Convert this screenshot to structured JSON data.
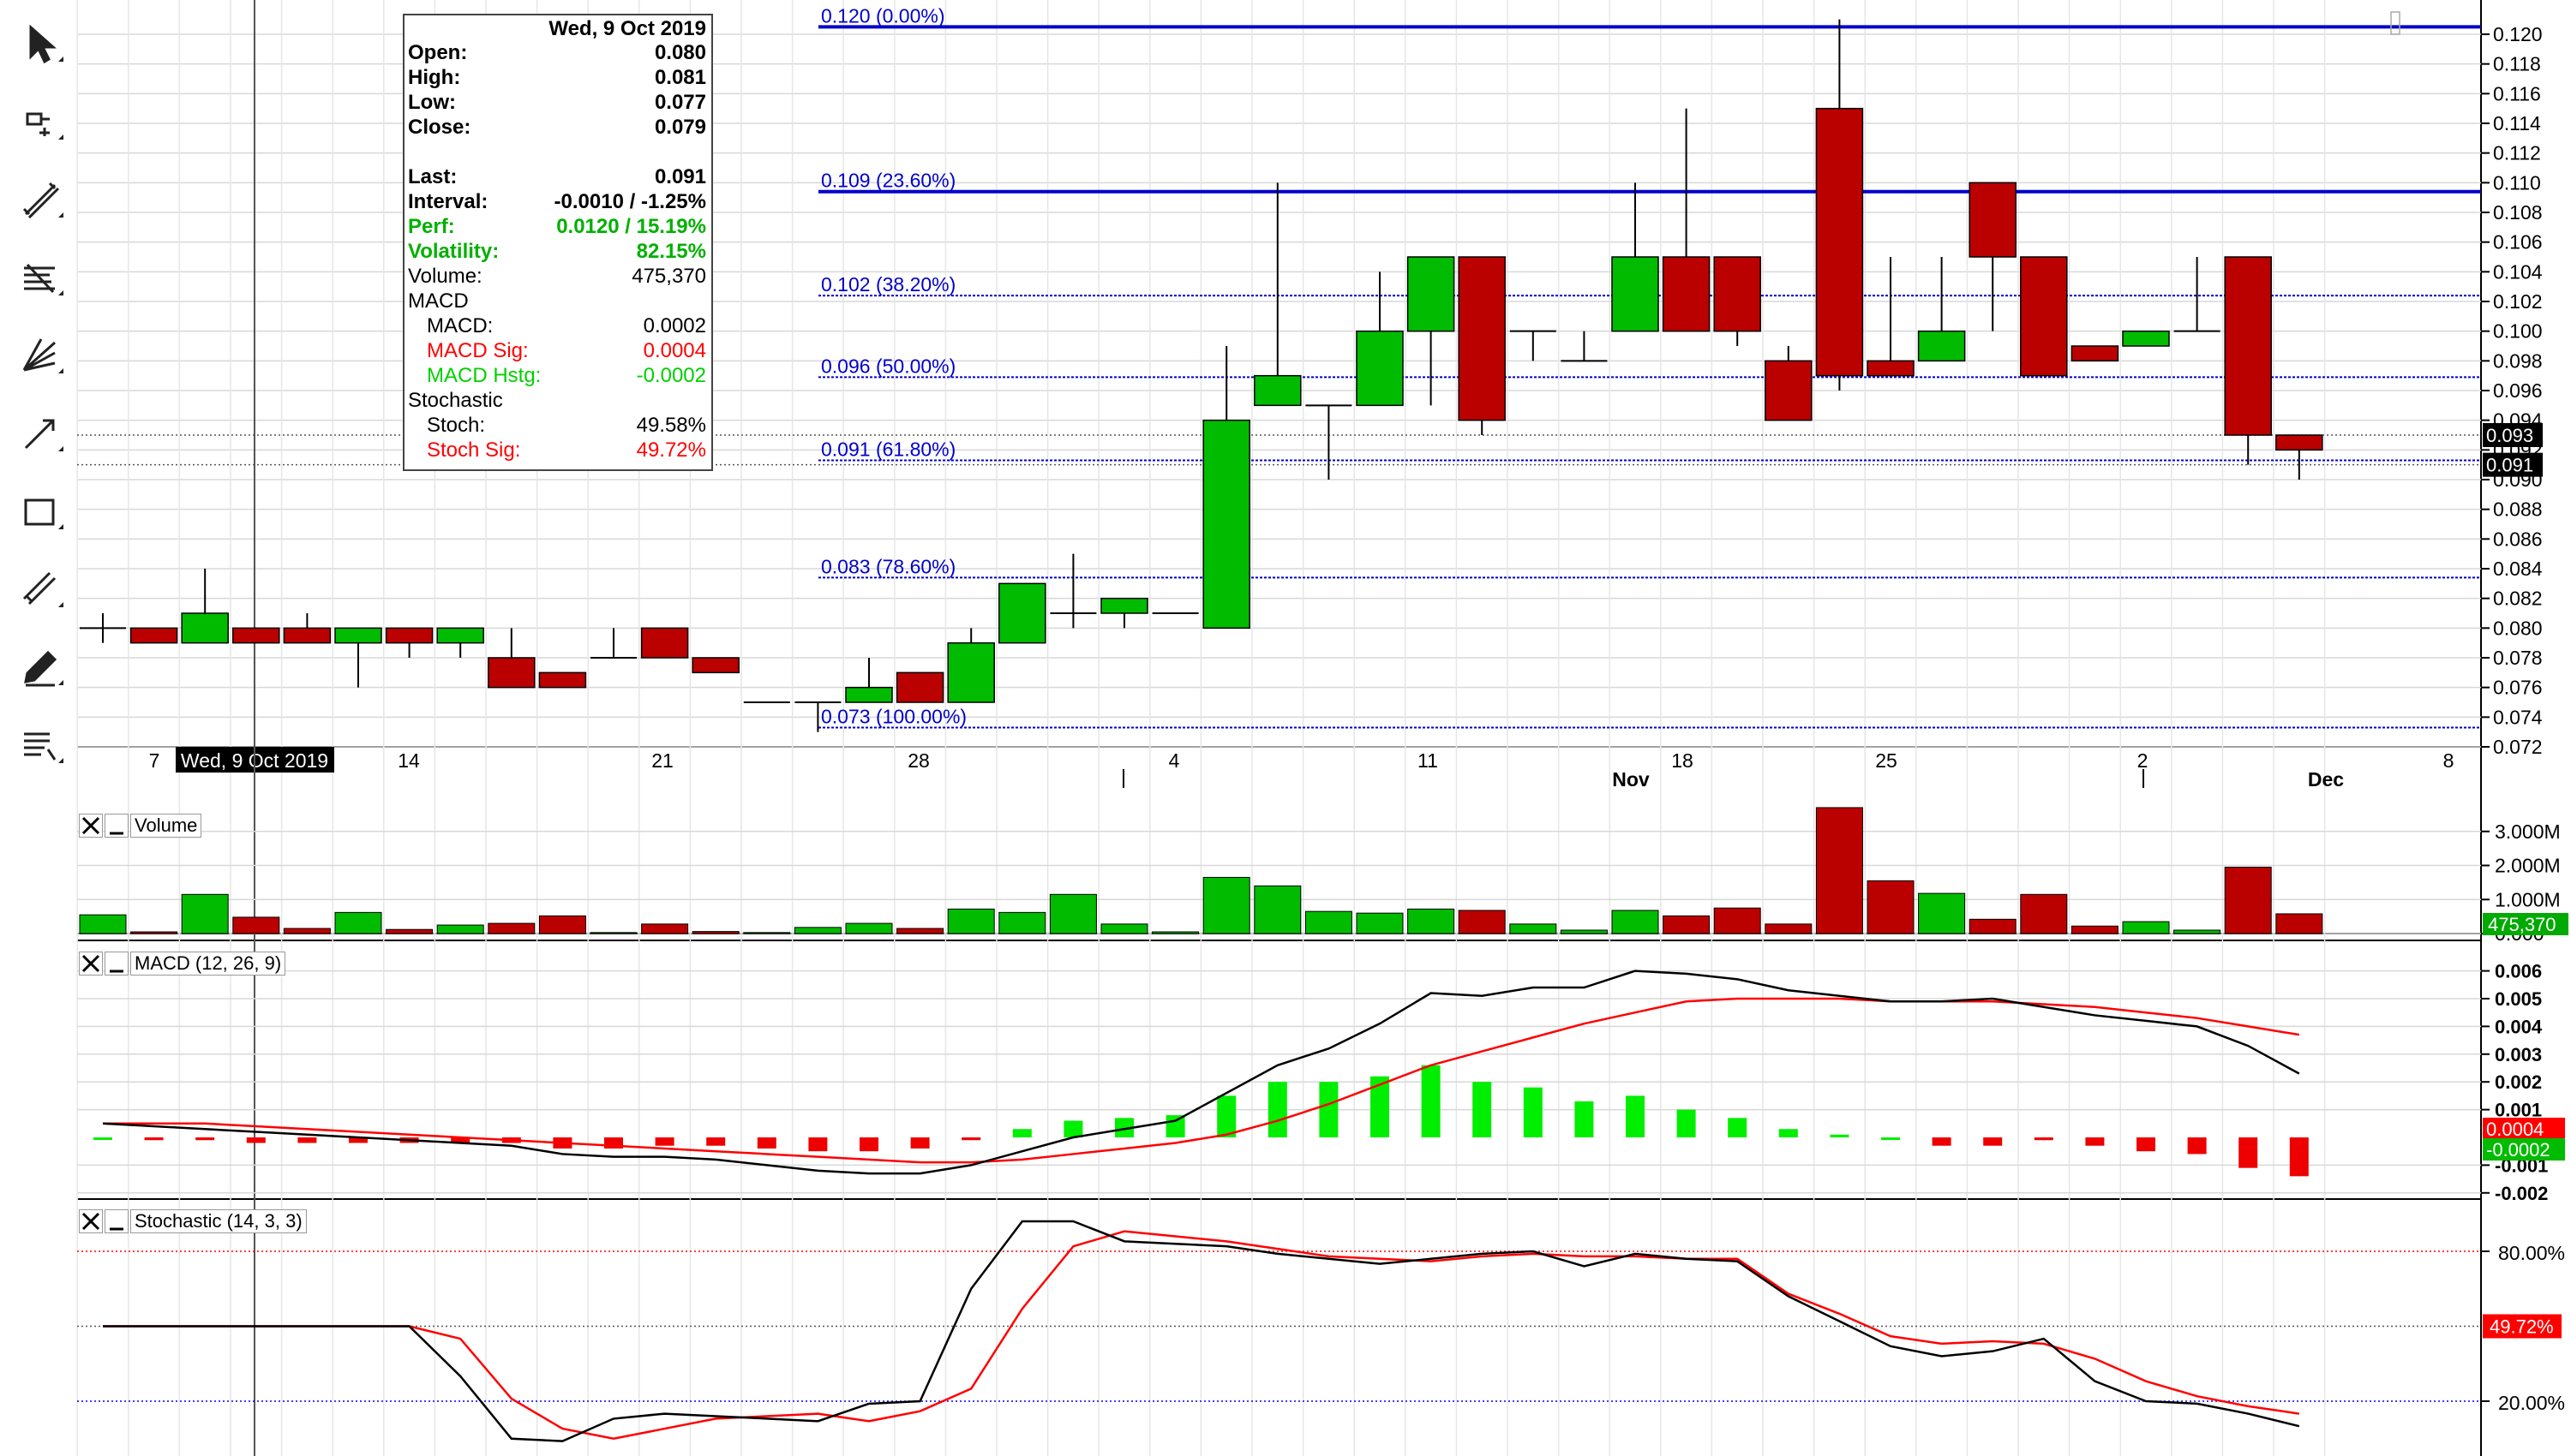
{
  "toolbar": {
    "icons": [
      "pointer-icon",
      "crosshair-icon",
      "trendline-icon",
      "fibonacci-icon",
      "gann-fan-icon",
      "arrow-icon",
      "rectangle-icon",
      "channel-icon",
      "pencil-icon",
      "list-icon"
    ]
  },
  "info_box": {
    "date": "Wed, 9 Oct 2019",
    "rows": [
      {
        "label": "Open:",
        "value": "0.080",
        "style": "b"
      },
      {
        "label": "High:",
        "value": "0.081",
        "style": "b"
      },
      {
        "label": "Low:",
        "value": "0.077",
        "style": "b"
      },
      {
        "label": "Close:",
        "value": "0.079",
        "style": "b"
      },
      {
        "label": "",
        "value": "",
        "style": ""
      },
      {
        "label": "Last:",
        "value": "0.091",
        "style": "b"
      },
      {
        "label": "Interval:",
        "value": "-0.0010 / -1.25%",
        "style": "b"
      },
      {
        "label": "Perf:",
        "value": "0.0120 / 15.19%",
        "style": "b g"
      },
      {
        "label": "Volatility:",
        "value": "82.15%",
        "style": "b g"
      },
      {
        "label": "Volume:",
        "value": "475,370",
        "style": ""
      },
      {
        "label": "MACD",
        "value": "",
        "style": ""
      },
      {
        "label": "  MACD:",
        "value": "0.0002",
        "style": "ind"
      },
      {
        "label": "  MACD Sig:",
        "value": "0.0004",
        "style": "ind r"
      },
      {
        "label": "  MACD Hstg:",
        "value": "-0.0002",
        "style": "ind lg"
      },
      {
        "label": "Stochastic",
        "value": "",
        "style": ""
      },
      {
        "label": "  Stoch:",
        "value": "49.58%",
        "style": "ind"
      },
      {
        "label": "  Stoch Sig:",
        "value": "49.72%",
        "style": "ind r"
      }
    ]
  },
  "panels": {
    "volume_title": "Volume",
    "macd_title": "MACD (12, 26, 9)",
    "stoch_title": "Stochastic (14, 3, 3)"
  },
  "colors": {
    "up": "#00bb00",
    "down": "#bb0000",
    "fib": "#0000cc",
    "grid": "#d8d8d8",
    "crosshair": "#555555"
  },
  "chart_data": {
    "type": "candlestick",
    "x_labels": [
      "7",
      "Wed, 9 Oct 2019",
      "14",
      "21",
      "28",
      "4",
      "11",
      "18",
      "25",
      "2",
      "8"
    ],
    "month_labels": [
      "Nov",
      "Dec"
    ],
    "y_ticks": [
      "0.120",
      "0.118",
      "0.116",
      "0.114",
      "0.112",
      "0.110",
      "0.108",
      "0.106",
      "0.104",
      "0.102",
      "0.100",
      "0.098",
      "0.096",
      "0.094",
      "0.092",
      "0.090",
      "0.088",
      "0.086",
      "0.084",
      "0.082",
      "0.080",
      "0.078",
      "0.076",
      "0.074",
      "0.072"
    ],
    "price_labels": {
      "last": "0.091",
      "prev": "0.093",
      "hidden": "0.092"
    },
    "fib_levels": [
      {
        "price": 0.1205,
        "label": "0.120  (0.00%)"
      },
      {
        "price": 0.1094,
        "label": "0.109  (23.60%)"
      },
      {
        "price": 0.1024,
        "label": "0.102  (38.20%)"
      },
      {
        "price": 0.0969,
        "label": "0.096  (50.00%)"
      },
      {
        "price": 0.0913,
        "label": "0.091  (61.80%)"
      },
      {
        "price": 0.0834,
        "label": "0.083  (78.60%)"
      },
      {
        "price": 0.0733,
        "label": "0.073  (100.00%)"
      }
    ],
    "candles": [
      {
        "o": 0.08,
        "h": 0.081,
        "l": 0.079,
        "c": 0.08,
        "v": 0.55
      },
      {
        "o": 0.08,
        "h": 0.08,
        "l": 0.079,
        "c": 0.079,
        "v": 0.05
      },
      {
        "o": 0.079,
        "h": 0.084,
        "l": 0.079,
        "c": 0.081,
        "v": 1.15
      },
      {
        "o": 0.08,
        "h": 0.08,
        "l": 0.079,
        "c": 0.079,
        "v": 0.48
      },
      {
        "o": 0.08,
        "h": 0.081,
        "l": 0.079,
        "c": 0.079,
        "v": 0.15
      },
      {
        "o": 0.079,
        "h": 0.08,
        "l": 0.076,
        "c": 0.08,
        "v": 0.62
      },
      {
        "o": 0.08,
        "h": 0.08,
        "l": 0.078,
        "c": 0.079,
        "v": 0.12
      },
      {
        "o": 0.079,
        "h": 0.08,
        "l": 0.078,
        "c": 0.08,
        "v": 0.25
      },
      {
        "o": 0.078,
        "h": 0.08,
        "l": 0.076,
        "c": 0.076,
        "v": 0.3
      },
      {
        "o": 0.077,
        "h": 0.077,
        "l": 0.076,
        "c": 0.076,
        "v": 0.52
      },
      {
        "o": 0.078,
        "h": 0.08,
        "l": 0.078,
        "c": 0.078,
        "v": 0.03
      },
      {
        "o": 0.08,
        "h": 0.08,
        "l": 0.078,
        "c": 0.078,
        "v": 0.28
      },
      {
        "o": 0.078,
        "h": 0.078,
        "l": 0.077,
        "c": 0.077,
        "v": 0.06
      },
      {
        "o": 0.075,
        "h": 0.075,
        "l": 0.075,
        "c": 0.075,
        "v": 0.03
      },
      {
        "o": 0.075,
        "h": 0.075,
        "l": 0.073,
        "c": 0.075,
        "v": 0.18
      },
      {
        "o": 0.075,
        "h": 0.078,
        "l": 0.075,
        "c": 0.076,
        "v": 0.3
      },
      {
        "o": 0.077,
        "h": 0.077,
        "l": 0.075,
        "c": 0.075,
        "v": 0.15
      },
      {
        "o": 0.075,
        "h": 0.08,
        "l": 0.075,
        "c": 0.079,
        "v": 0.72
      },
      {
        "o": 0.079,
        "h": 0.083,
        "l": 0.079,
        "c": 0.083,
        "v": 0.62
      },
      {
        "o": 0.081,
        "h": 0.085,
        "l": 0.08,
        "c": 0.081,
        "v": 1.15
      },
      {
        "o": 0.081,
        "h": 0.082,
        "l": 0.08,
        "c": 0.082,
        "v": 0.28
      },
      {
        "o": 0.081,
        "h": 0.081,
        "l": 0.081,
        "c": 0.081,
        "v": 0.05
      },
      {
        "o": 0.08,
        "h": 0.099,
        "l": 0.08,
        "c": 0.094,
        "v": 1.65
      },
      {
        "o": 0.095,
        "h": 0.11,
        "l": 0.095,
        "c": 0.097,
        "v": 1.4
      },
      {
        "o": 0.095,
        "h": 0.095,
        "l": 0.09,
        "c": 0.095,
        "v": 0.65
      },
      {
        "o": 0.095,
        "h": 0.104,
        "l": 0.095,
        "c": 0.1,
        "v": 0.6
      },
      {
        "o": 0.1,
        "h": 0.105,
        "l": 0.095,
        "c": 0.105,
        "v": 0.72
      },
      {
        "o": 0.105,
        "h": 0.105,
        "l": 0.093,
        "c": 0.094,
        "v": 0.68
      },
      {
        "o": 0.1,
        "h": 0.1,
        "l": 0.098,
        "c": 0.1,
        "v": 0.28
      },
      {
        "o": 0.098,
        "h": 0.1,
        "l": 0.098,
        "c": 0.098,
        "v": 0.1
      },
      {
        "o": 0.1,
        "h": 0.11,
        "l": 0.1,
        "c": 0.105,
        "v": 0.68
      },
      {
        "o": 0.105,
        "h": 0.115,
        "l": 0.1,
        "c": 0.1,
        "v": 0.52
      },
      {
        "o": 0.105,
        "h": 0.105,
        "l": 0.099,
        "c": 0.1,
        "v": 0.75
      },
      {
        "o": 0.098,
        "h": 0.099,
        "l": 0.094,
        "c": 0.094,
        "v": 0.28
      },
      {
        "o": 0.115,
        "h": 0.121,
        "l": 0.096,
        "c": 0.097,
        "v": 3.7
      },
      {
        "o": 0.098,
        "h": 0.105,
        "l": 0.097,
        "c": 0.097,
        "v": 1.55
      },
      {
        "o": 0.098,
        "h": 0.105,
        "l": 0.098,
        "c": 0.1,
        "v": 1.18
      },
      {
        "o": 0.11,
        "h": 0.11,
        "l": 0.1,
        "c": 0.105,
        "v": 0.42
      },
      {
        "o": 0.105,
        "h": 0.105,
        "l": 0.097,
        "c": 0.097,
        "v": 1.15
      },
      {
        "o": 0.099,
        "h": 0.099,
        "l": 0.098,
        "c": 0.098,
        "v": 0.22
      },
      {
        "o": 0.099,
        "h": 0.1,
        "l": 0.099,
        "c": 0.1,
        "v": 0.35
      },
      {
        "o": 0.1,
        "h": 0.105,
        "l": 0.1,
        "c": 0.1,
        "v": 0.1
      },
      {
        "o": 0.105,
        "h": 0.105,
        "l": 0.091,
        "c": 0.093,
        "v": 1.95
      },
      {
        "o": 0.093,
        "h": 0.093,
        "l": 0.09,
        "c": 0.092,
        "v": 0.58
      }
    ],
    "volume_ticks": [
      "3.000M",
      "2.000M",
      "1.000M",
      "0.000"
    ],
    "volume_last": "475,370",
    "macd": {
      "ticks": [
        "0.006",
        "0.005",
        "0.004",
        "0.003",
        "0.002",
        "0.001",
        "-0.001",
        "-0.002"
      ],
      "macd": [
        0.0005,
        0.0004,
        0.0003,
        0.0002,
        0.0001,
        0.0,
        -0.0001,
        -0.0002,
        -0.0003,
        -0.0006,
        -0.0007,
        -0.0007,
        -0.0008,
        -0.001,
        -0.0012,
        -0.0013,
        -0.0013,
        -0.001,
        -0.0005,
        0.0,
        0.0003,
        0.0006,
        0.0016,
        0.0026,
        0.0032,
        0.0041,
        0.0052,
        0.0051,
        0.0054,
        0.0054,
        0.006,
        0.0059,
        0.0057,
        0.0053,
        0.0051,
        0.0049,
        0.0049,
        0.005,
        0.0047,
        0.0044,
        0.0042,
        0.004,
        0.0033,
        0.0023
      ],
      "signal": [
        0.0005,
        0.0005,
        0.0005,
        0.0004,
        0.0003,
        0.0002,
        0.0001,
        0.0,
        -0.0001,
        -0.0002,
        -0.0003,
        -0.0004,
        -0.0005,
        -0.0006,
        -0.0007,
        -0.0008,
        -0.0009,
        -0.0009,
        -0.0008,
        -0.0006,
        -0.0004,
        -0.0002,
        0.0001,
        0.0006,
        0.0012,
        0.0019,
        0.0026,
        0.0031,
        0.0036,
        0.0041,
        0.0045,
        0.0049,
        0.005,
        0.005,
        0.005,
        0.0049,
        0.0049,
        0.0049,
        0.0048,
        0.0047,
        0.0045,
        0.0043,
        0.004,
        0.0037
      ],
      "hist": [
        0.0,
        -0.0001,
        -0.0001,
        -0.0002,
        -0.0002,
        -0.0002,
        -0.0002,
        -0.0002,
        -0.0002,
        -0.0004,
        -0.0004,
        -0.0003,
        -0.0003,
        -0.0004,
        -0.0005,
        -0.0005,
        -0.0004,
        -0.0001,
        0.0003,
        0.0006,
        0.0007,
        0.0008,
        0.0015,
        0.002,
        0.002,
        0.0022,
        0.0026,
        0.002,
        0.0018,
        0.0013,
        0.0015,
        0.001,
        0.0007,
        0.0003,
        0.0001,
        0.0,
        -0.0003,
        -0.0003,
        -0.0001,
        -0.0003,
        -0.0005,
        -0.0006,
        -0.0011,
        -0.0014
      ],
      "macd_label": "0.0004",
      "hist_label": "-0.0002"
    },
    "stochastic": {
      "ticks": [
        "80.00%",
        "20.00%"
      ],
      "stoch": [
        50,
        50,
        50,
        50,
        50,
        50,
        50,
        30,
        5,
        4,
        13,
        15,
        14,
        13,
        12,
        19,
        20,
        65,
        92,
        92,
        84,
        83,
        82,
        79,
        77,
        75,
        77,
        79,
        80,
        74,
        79,
        77,
        76,
        62,
        52,
        42,
        38,
        40,
        45,
        28,
        20,
        19,
        15,
        10
      ],
      "signal": [
        50,
        50,
        50,
        50,
        50,
        50,
        50,
        45,
        21,
        9,
        5,
        9,
        13,
        14,
        15,
        12,
        16,
        25,
        57,
        82,
        88,
        86,
        84,
        81,
        78,
        77,
        76,
        78,
        79,
        78,
        78,
        77,
        77,
        63,
        55,
        46,
        43,
        44,
        43,
        37,
        28,
        22,
        18,
        15
      ],
      "sig_label": "49.72%"
    }
  }
}
